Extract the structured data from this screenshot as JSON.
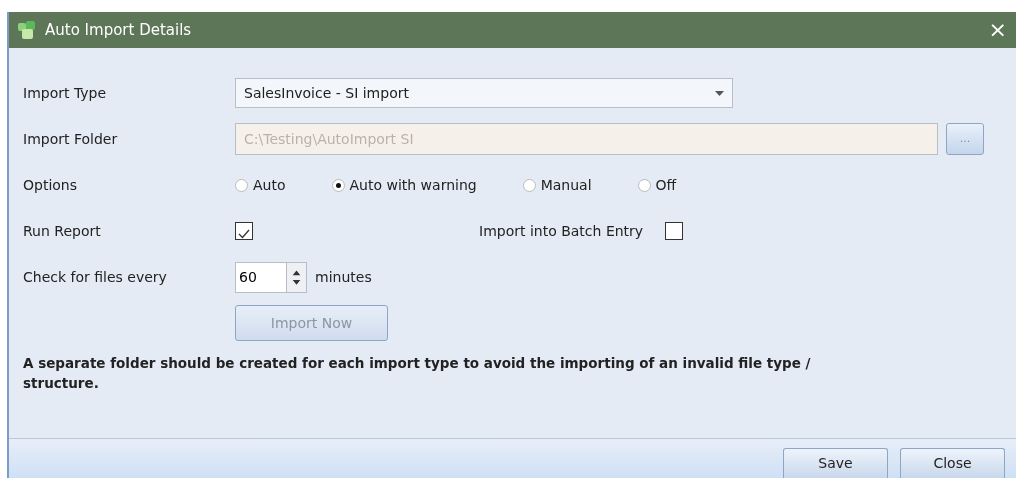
{
  "window": {
    "title": "Auto Import Details",
    "close": "×"
  },
  "import_type": {
    "label": "Import Type",
    "value": "SalesInvoice - SI import"
  },
  "import_folder": {
    "label": "Import Folder",
    "value": "C:\\Testing\\AutoImport SI",
    "disabled": true,
    "browse": "..."
  },
  "options": {
    "label": "Options",
    "items": [
      {
        "label": "Auto",
        "selected": false
      },
      {
        "label": "Auto with warning",
        "selected": true
      },
      {
        "label": "Manual",
        "selected": false
      },
      {
        "label": "Off",
        "selected": false
      }
    ]
  },
  "run_report": {
    "label": "Run Report",
    "checked": true
  },
  "batch_entry": {
    "label": "Import into Batch Entry",
    "checked": false
  },
  "check_every": {
    "label": "Check for files every",
    "value": "60",
    "unit": "minutes"
  },
  "import_now": {
    "label": "Import Now",
    "disabled": true
  },
  "note": "A separate folder should be created for each import type to avoid the importing of an invalid file type / structure.",
  "buttons": [
    "Save",
    "Close"
  ]
}
